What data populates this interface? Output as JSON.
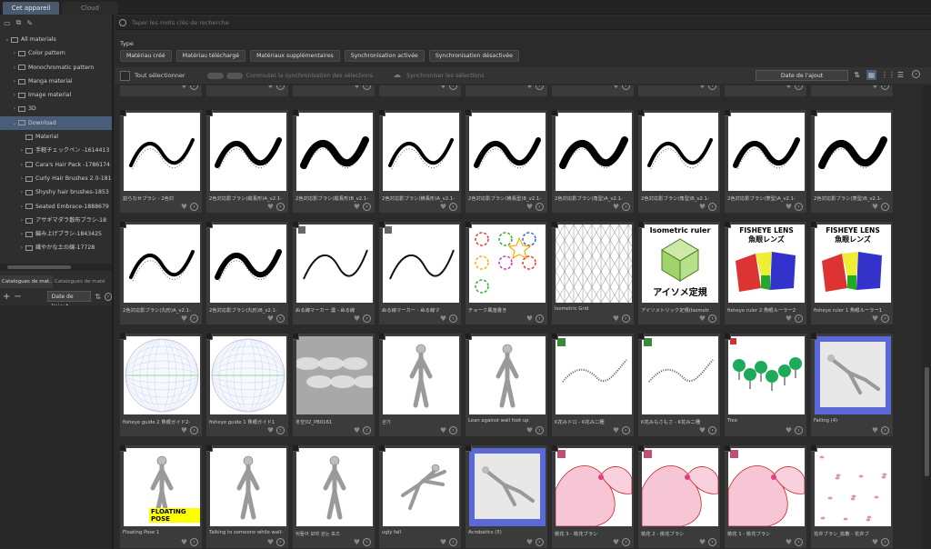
{
  "tabs": {
    "device": "Cet appareil",
    "cloud": "Cloud"
  },
  "search": {
    "placeholder": "Taper les mots clés de recherche"
  },
  "tree": [
    {
      "label": "All materials",
      "arrow": "⌄",
      "indent": 0
    },
    {
      "label": "Color pattern",
      "arrow": "›",
      "indent": 1
    },
    {
      "label": "Monochromatic pattern",
      "arrow": "›",
      "indent": 1
    },
    {
      "label": "Manga material",
      "arrow": "›",
      "indent": 1
    },
    {
      "label": "Image material",
      "arrow": "›",
      "indent": 1
    },
    {
      "label": "3D",
      "arrow": "›",
      "indent": 1
    },
    {
      "label": "Download",
      "arrow": "⌄",
      "indent": 1,
      "selected": true
    },
    {
      "label": "Material",
      "arrow": "",
      "indent": 2
    },
    {
      "label": "手軽チェックペン -1614413",
      "arrow": "›",
      "indent": 2
    },
    {
      "label": "Cara's Hair Pack -1786174",
      "arrow": "›",
      "indent": 2
    },
    {
      "label": "Curly Hair Brushes 2.0-181",
      "arrow": "›",
      "indent": 2
    },
    {
      "label": "Shyshy hair brushes-1853",
      "arrow": "›",
      "indent": 2
    },
    {
      "label": "Seated Embrace-1888679",
      "arrow": "›",
      "indent": 2
    },
    {
      "label": "アサギマダラ散布ブラシ-18",
      "arrow": "›",
      "indent": 2
    },
    {
      "label": "編み上げブラシ-1843425",
      "arrow": "›",
      "indent": 2
    },
    {
      "label": "繊やかな土の線-17728",
      "arrow": "›",
      "indent": 2
    }
  ],
  "catalog_tabs": [
    "Catalogues de mat...",
    "Catalogues de matériaux..."
  ],
  "sort_sidebar": "Date de l'ajout",
  "type_label": "Type",
  "chips": [
    "Matériau créé",
    "Matériau téléchargé",
    "Matériaux supplémentaires",
    "Synchronisation activée",
    "Synchronisation désactivée"
  ],
  "toolbar": {
    "select_all": "Tout sélectionner",
    "toggle_sync": "Commuter la synchronisation des sélections",
    "sync_selected": "Synchroniser les sélections",
    "sort": "Date de l'ajout"
  },
  "rows": [
    [
      {
        "caption": "割らなせブラシ - 2色対",
        "thumb": "brush"
      },
      {
        "caption": "2色対応影ブラシ(縦長形)A_v2.1-",
        "thumb": "brush"
      },
      {
        "caption": "2色対応影ブラシ(縦長形)B_v2.1-",
        "thumb": "brush"
      },
      {
        "caption": "2色対応影ブラシ(横長形)A_v2.1-",
        "thumb": "brush"
      },
      {
        "caption": "2色対応影ブラシ(横長型)B_v2.1-",
        "thumb": "brush"
      },
      {
        "caption": "2色対応影ブラシ(角型)A_v2.1-",
        "thumb": "brush"
      },
      {
        "caption": "2色対応影ブラシ(角型)B_v2.1-",
        "thumb": "brush"
      },
      {
        "caption": "2色対応影ブラシ(菱型)A_v2.1-",
        "thumb": "brush"
      },
      {
        "caption": "2色対応影ブラシ(菱型)B_v2.1-",
        "thumb": "brush"
      }
    ],
    [
      {
        "caption": "2色対応影ブラシ(丸形)A_v2.1-",
        "thumb": "brush"
      },
      {
        "caption": "2色対応影ブラシ(丸形)B_v2.1-",
        "thumb": "brush"
      },
      {
        "caption": "ぬる線マーカー 濃 - ぬる線",
        "thumb": "line"
      },
      {
        "caption": "ぬる線マーカー - ぬる線マ",
        "thumb": "line"
      },
      {
        "caption": "チョーク風落書き",
        "thumb": "doodle"
      },
      {
        "caption": "Isometric Grid",
        "thumb": "isogrid"
      },
      {
        "caption": "アイソメトリック定規(Isometr",
        "thumb": "isoruler"
      },
      {
        "caption": "fisheye ruler 2 魚眼ルーラー2",
        "thumb": "fisheye"
      },
      {
        "caption": "fisheye ruler 1 魚眼ルーラー1",
        "thumb": "fisheye"
      }
    ],
    [
      {
        "caption": "fisheye guide 2 魚眼ガイド2-",
        "thumb": "sphere"
      },
      {
        "caption": "fisheye  guide 1 魚眼ガイド1",
        "thumb": "sphere"
      },
      {
        "caption": "冬空02_PB0161",
        "thumb": "sky"
      },
      {
        "caption": "걷기",
        "thumb": "figure"
      },
      {
        "caption": "Lean against wall foot up",
        "thumb": "figure"
      },
      {
        "caption": "K花みドロ - K花み二種",
        "thumb": "scribble"
      },
      {
        "caption": "K花みもさもさ - K花み二種",
        "thumb": "scribble"
      },
      {
        "caption": "Tree",
        "thumb": "tree"
      },
      {
        "caption": "Falling (4)",
        "thumb": "falling"
      }
    ],
    [
      {
        "caption": "Floating Pose 1",
        "thumb": "figure"
      },
      {
        "caption": "Talking to someone while wall-",
        "thumb": "figure"
      },
      {
        "caption": "뒤돌아 보며 걷는 포즈",
        "thumb": "figure"
      },
      {
        "caption": "ugly fall",
        "thumb": "fall"
      },
      {
        "caption": "Acrobatics (5)",
        "thumb": "falling"
      },
      {
        "caption": "桃花 3 - 桃花ブラシ",
        "thumb": "petal"
      },
      {
        "caption": "桃花 2 - 桃花ブラシ",
        "thumb": "petal"
      },
      {
        "caption": "桃花 1 - 桃花ブラシ",
        "thumb": "petal"
      },
      {
        "caption": "花弁ブラシ_拡散 - 花弁ブ",
        "thumb": "petals"
      }
    ]
  ],
  "thumb_text": {
    "isoruler": "Isometric ruler",
    "isoruler_jp": "アイソメ定規",
    "fisheye": "FISHEYE LENS",
    "fisheye_jp": "魚眼レンズ",
    "floating": "FLOATING POSE"
  }
}
